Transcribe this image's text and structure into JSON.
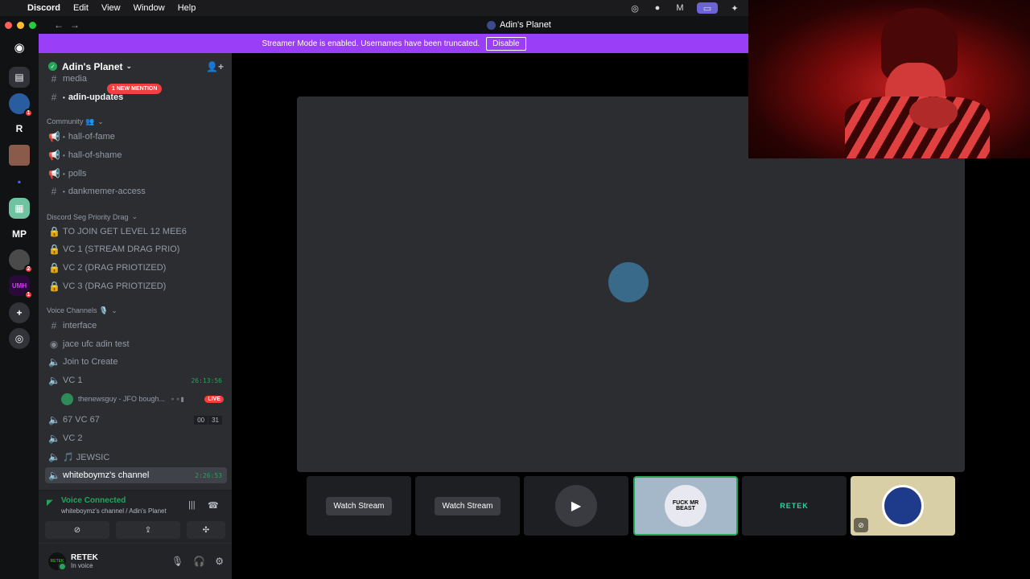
{
  "menubar": {
    "app": "Discord",
    "items": [
      "Edit",
      "View",
      "Window",
      "Help"
    ]
  },
  "titlebar": {
    "title": "Adin's Planet"
  },
  "banner": {
    "text": "Streamer Mode is enabled. Usernames have been truncated.",
    "button": "Disable"
  },
  "rail": {
    "r_label": "R",
    "umh_label": "UMH",
    "badges": [
      "1",
      "2",
      "1"
    ],
    "mp_label": "MP"
  },
  "guild": {
    "name": "Adin's Planet",
    "mention_pill": "1 NEW MENTION"
  },
  "channels": {
    "media": "media",
    "adin_updates": "adin-updates",
    "cat_community": "Community 👥",
    "hall_of_fame": "hall-of-fame",
    "hall_of_shame": "hall-of-shame",
    "polls": "polls",
    "dankmemer": "dankmemer-access",
    "cat_drag": "Discord Seg Priority Drag",
    "join_level": "TO JOIN GET LEVEL 12 MEE6",
    "vc1_stream": "VC 1 (STREAM DRAG PRIO)",
    "vc2_drag": "VC 2 (DRAG PRIOTIZED)",
    "vc3_drag": "VC 3 (DRAG PRIOTIZED)",
    "cat_voice": "Voice Channels 🎙️",
    "interface": "interface",
    "jace": "jace ufc adin test",
    "join_create": "Join to Create",
    "vc1": "VC 1",
    "vc1_timer": "26:13:56",
    "vc1_user": "thenewsguy - JFO bough...",
    "live": "LIVE",
    "vc67": "67 VC 67",
    "vc67_count_a": "00",
    "vc67_count_b": "31",
    "vc2": "VC 2",
    "jewsic": "🎵 JEWSIC",
    "whiteboymz": "whiteboymz's channel",
    "whiteboymz_timer": "2:26:53"
  },
  "voice_panel": {
    "status": "Voice Connected",
    "sub": "whiteboymz's channel / Adin's Planet"
  },
  "user_panel": {
    "name": "RETEK",
    "status": "In voice",
    "avatar_text": "RETEK"
  },
  "tiles": {
    "watch_stream_1": "Watch Stream",
    "watch_stream_2": "Watch Stream",
    "sign_text": "FUCK MR BEAST",
    "retek": "RETEK"
  },
  "colors": {
    "banner": "#9a3ef8",
    "online": "#23a55a",
    "mention": "#f23f42",
    "sidebar": "#2b2d31",
    "rail": "#111214"
  }
}
